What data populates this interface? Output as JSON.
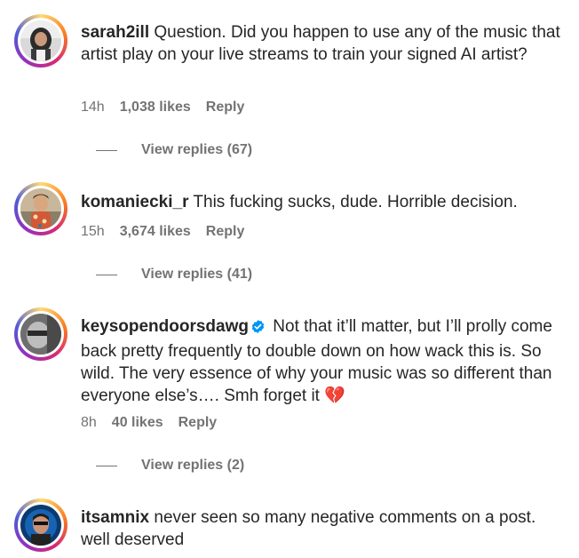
{
  "comments": [
    {
      "username": "sarah2ill",
      "text": "Question. Did you happen to use any of the music that artist play on your live streams to train your signed AI artist?",
      "time": "14h",
      "likes": "1,038 likes",
      "reply_label": "Reply",
      "view_replies": "View replies (67)",
      "verified": false
    },
    {
      "username": "komaniecki_r",
      "text": "This fucking sucks, dude. Horrible decision.",
      "time": "15h",
      "likes": "3,674 likes",
      "reply_label": "Reply",
      "view_replies": "View replies (41)",
      "verified": false
    },
    {
      "username": "keysopendoorsdawg",
      "text": "Not that it’ll matter, but I’ll prolly come back pretty frequently to double down on how wack this is. So wild. The very essence of why your music was so different than everyone else’s…. Smh forget it",
      "emoji": "💔",
      "time": "8h",
      "likes": "40 likes",
      "reply_label": "Reply",
      "view_replies": "View replies (2)",
      "verified": true
    },
    {
      "username": "itsamnix",
      "text": "never seen so many negative comments on a post. well deserved",
      "verified": false
    }
  ],
  "colors": {
    "text": "#262626",
    "muted": "#737373",
    "verified_badge": "#0095f6"
  }
}
